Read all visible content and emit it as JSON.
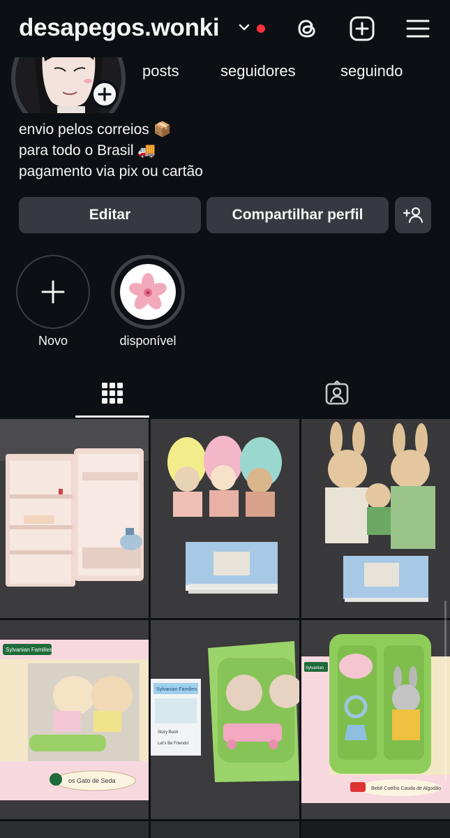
{
  "header": {
    "username": "desapegos.wonki",
    "notification_color": "#ff3040"
  },
  "profile": {
    "stats": {
      "posts_label": "posts",
      "followers_label": "seguidores",
      "following_label": "seguindo"
    },
    "bio": [
      "envio pelos correios 📦",
      "para todo o Brasil 🚚",
      "pagamento via pix ou cartão"
    ]
  },
  "actions": {
    "edit_label": "Editar",
    "share_label": "Compartilhar perfil"
  },
  "highlights": [
    {
      "label": "Novo",
      "icon": "plus-icon"
    },
    {
      "label": "disponível",
      "icon": "cherry-blossom"
    }
  ],
  "tabs": [
    {
      "name": "grid",
      "icon": "grid-icon",
      "active": true
    },
    {
      "name": "tagged",
      "icon": "tagged-person-icon",
      "active": false
    }
  ],
  "posts": [
    {
      "subject": "refrigerator-toy"
    },
    {
      "subject": "baby-figures-with-catalogue"
    },
    {
      "subject": "rabbit-family-with-catalogue"
    },
    {
      "subject": "silk-cat-twins-box",
      "box_brand": "Sylvanian Families",
      "box_caption": "os Gato de Seda"
    },
    {
      "subject": "sheep-twins-with-storybook",
      "book_brand": "Sylvanian Families",
      "book_caption_1": "Story Book",
      "book_caption_2": "Let's Be Friends!"
    },
    {
      "subject": "cottontail-rabbit-baby-box",
      "box_brand": "Sylvanian",
      "box_caption": "Bebê Coelho Cauda de Algodão"
    }
  ],
  "colors": {
    "background": "#0c1014",
    "button": "#363a40",
    "text": "#f5f5f5"
  }
}
